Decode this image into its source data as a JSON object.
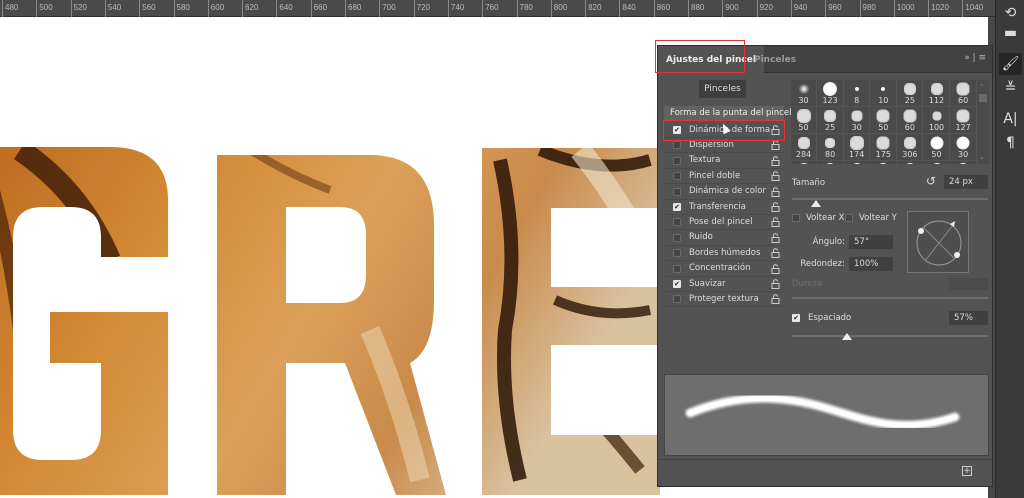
{
  "ruler": {
    "ticks": [
      "480",
      "500",
      "520",
      "540",
      "560",
      "580",
      "600",
      "620",
      "640",
      "660",
      "680",
      "700",
      "720",
      "740",
      "760",
      "780",
      "800",
      "820",
      "840",
      "860",
      "880",
      "900",
      "920",
      "940",
      "960",
      "980",
      "1000",
      "1020",
      "1040"
    ]
  },
  "canvas": {
    "letters": [
      "G",
      "R",
      "E"
    ]
  },
  "panel": {
    "tabs": [
      {
        "label": "Ajustes del pincel",
        "active": true
      },
      {
        "label": "Pinceles",
        "active": false
      }
    ],
    "tab_menu": "»  |  ≡",
    "brushes_button": "Pinceles",
    "brush_tip_shape": "Forma de la punta del pincel",
    "options": [
      {
        "label": "Dinámica de forma",
        "checked": true
      },
      {
        "label": "Dispersión",
        "checked": false
      },
      {
        "label": "Textura",
        "checked": false
      },
      {
        "label": "Pincel doble",
        "checked": false
      },
      {
        "label": "Dinámica de color",
        "checked": false
      },
      {
        "label": "Transferencia",
        "checked": true
      },
      {
        "label": "Pose del pincel",
        "checked": false
      },
      {
        "label": "Ruido",
        "checked": false
      },
      {
        "label": "Bordes húmedos",
        "checked": false
      },
      {
        "label": "Concentración",
        "checked": false
      },
      {
        "label": "Suavizar",
        "checked": true
      },
      {
        "label": "Proteger textura",
        "checked": false
      }
    ],
    "brush_sizes": [
      "30",
      "123",
      "8",
      "10",
      "25",
      "112",
      "60",
      "50",
      "25",
      "30",
      "50",
      "60",
      "100",
      "127",
      "284",
      "80",
      "174",
      "175",
      "306",
      "50",
      "30"
    ],
    "size": {
      "label": "Tamaño",
      "value": "24 px",
      "slider_fraction": 0.12
    },
    "flip_x": {
      "label": "Voltear X",
      "checked": false
    },
    "flip_y": {
      "label": "Voltear Y",
      "checked": false
    },
    "angle": {
      "label": "Ángulo:",
      "value": "57°"
    },
    "roundness": {
      "label": "Redondez:",
      "value": "100%"
    },
    "hardness": {
      "label": "Dureza",
      "value": ""
    },
    "spacing": {
      "label": "Espaciado",
      "checked": true,
      "value": "57%",
      "slider_fraction": 0.28
    }
  },
  "colors": {
    "panel": "#535353",
    "highlight": "#e0343a"
  }
}
